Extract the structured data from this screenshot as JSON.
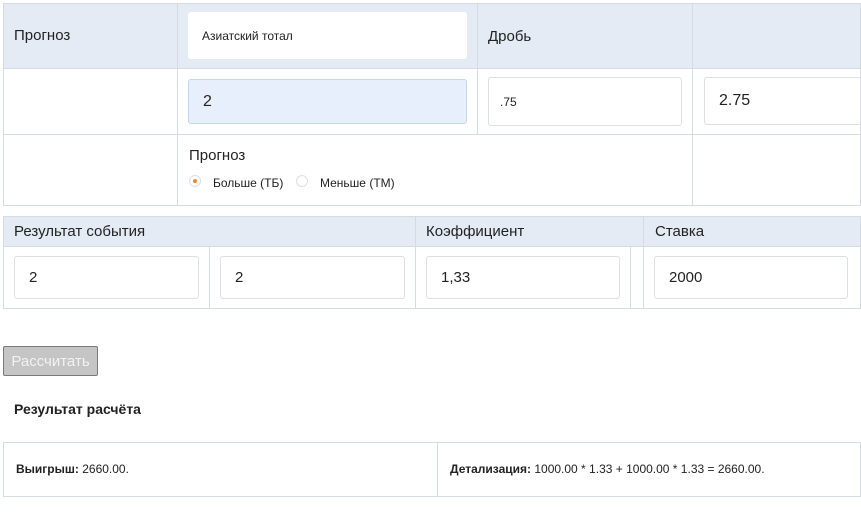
{
  "top": {
    "row1_label": "Прогноз",
    "bet_type_value": "Азиатский тотал",
    "fraction_label": "Дробь",
    "total_whole": "2",
    "total_fraction": ".75",
    "total_sum": "2.75",
    "forecast_label": "Прогноз",
    "radio_over": "Больше (ТБ)",
    "radio_under": "Меньше (ТМ)"
  },
  "mid": {
    "result_label": "Результат события",
    "coef_label": "Коэффициент",
    "stake_label": "Ставка",
    "score1": "2",
    "score2": "2",
    "coef": "1,33",
    "stake": "2000"
  },
  "calc_button": "Рассчитать",
  "result": {
    "title": "Результат расчёта",
    "win_label": "Выигрыш:",
    "win_value": "2660.00.",
    "detail_label": "Детализация:",
    "detail_value": "1000.00 * 1.33 + 1000.00 * 1.33 = 2660.00."
  }
}
